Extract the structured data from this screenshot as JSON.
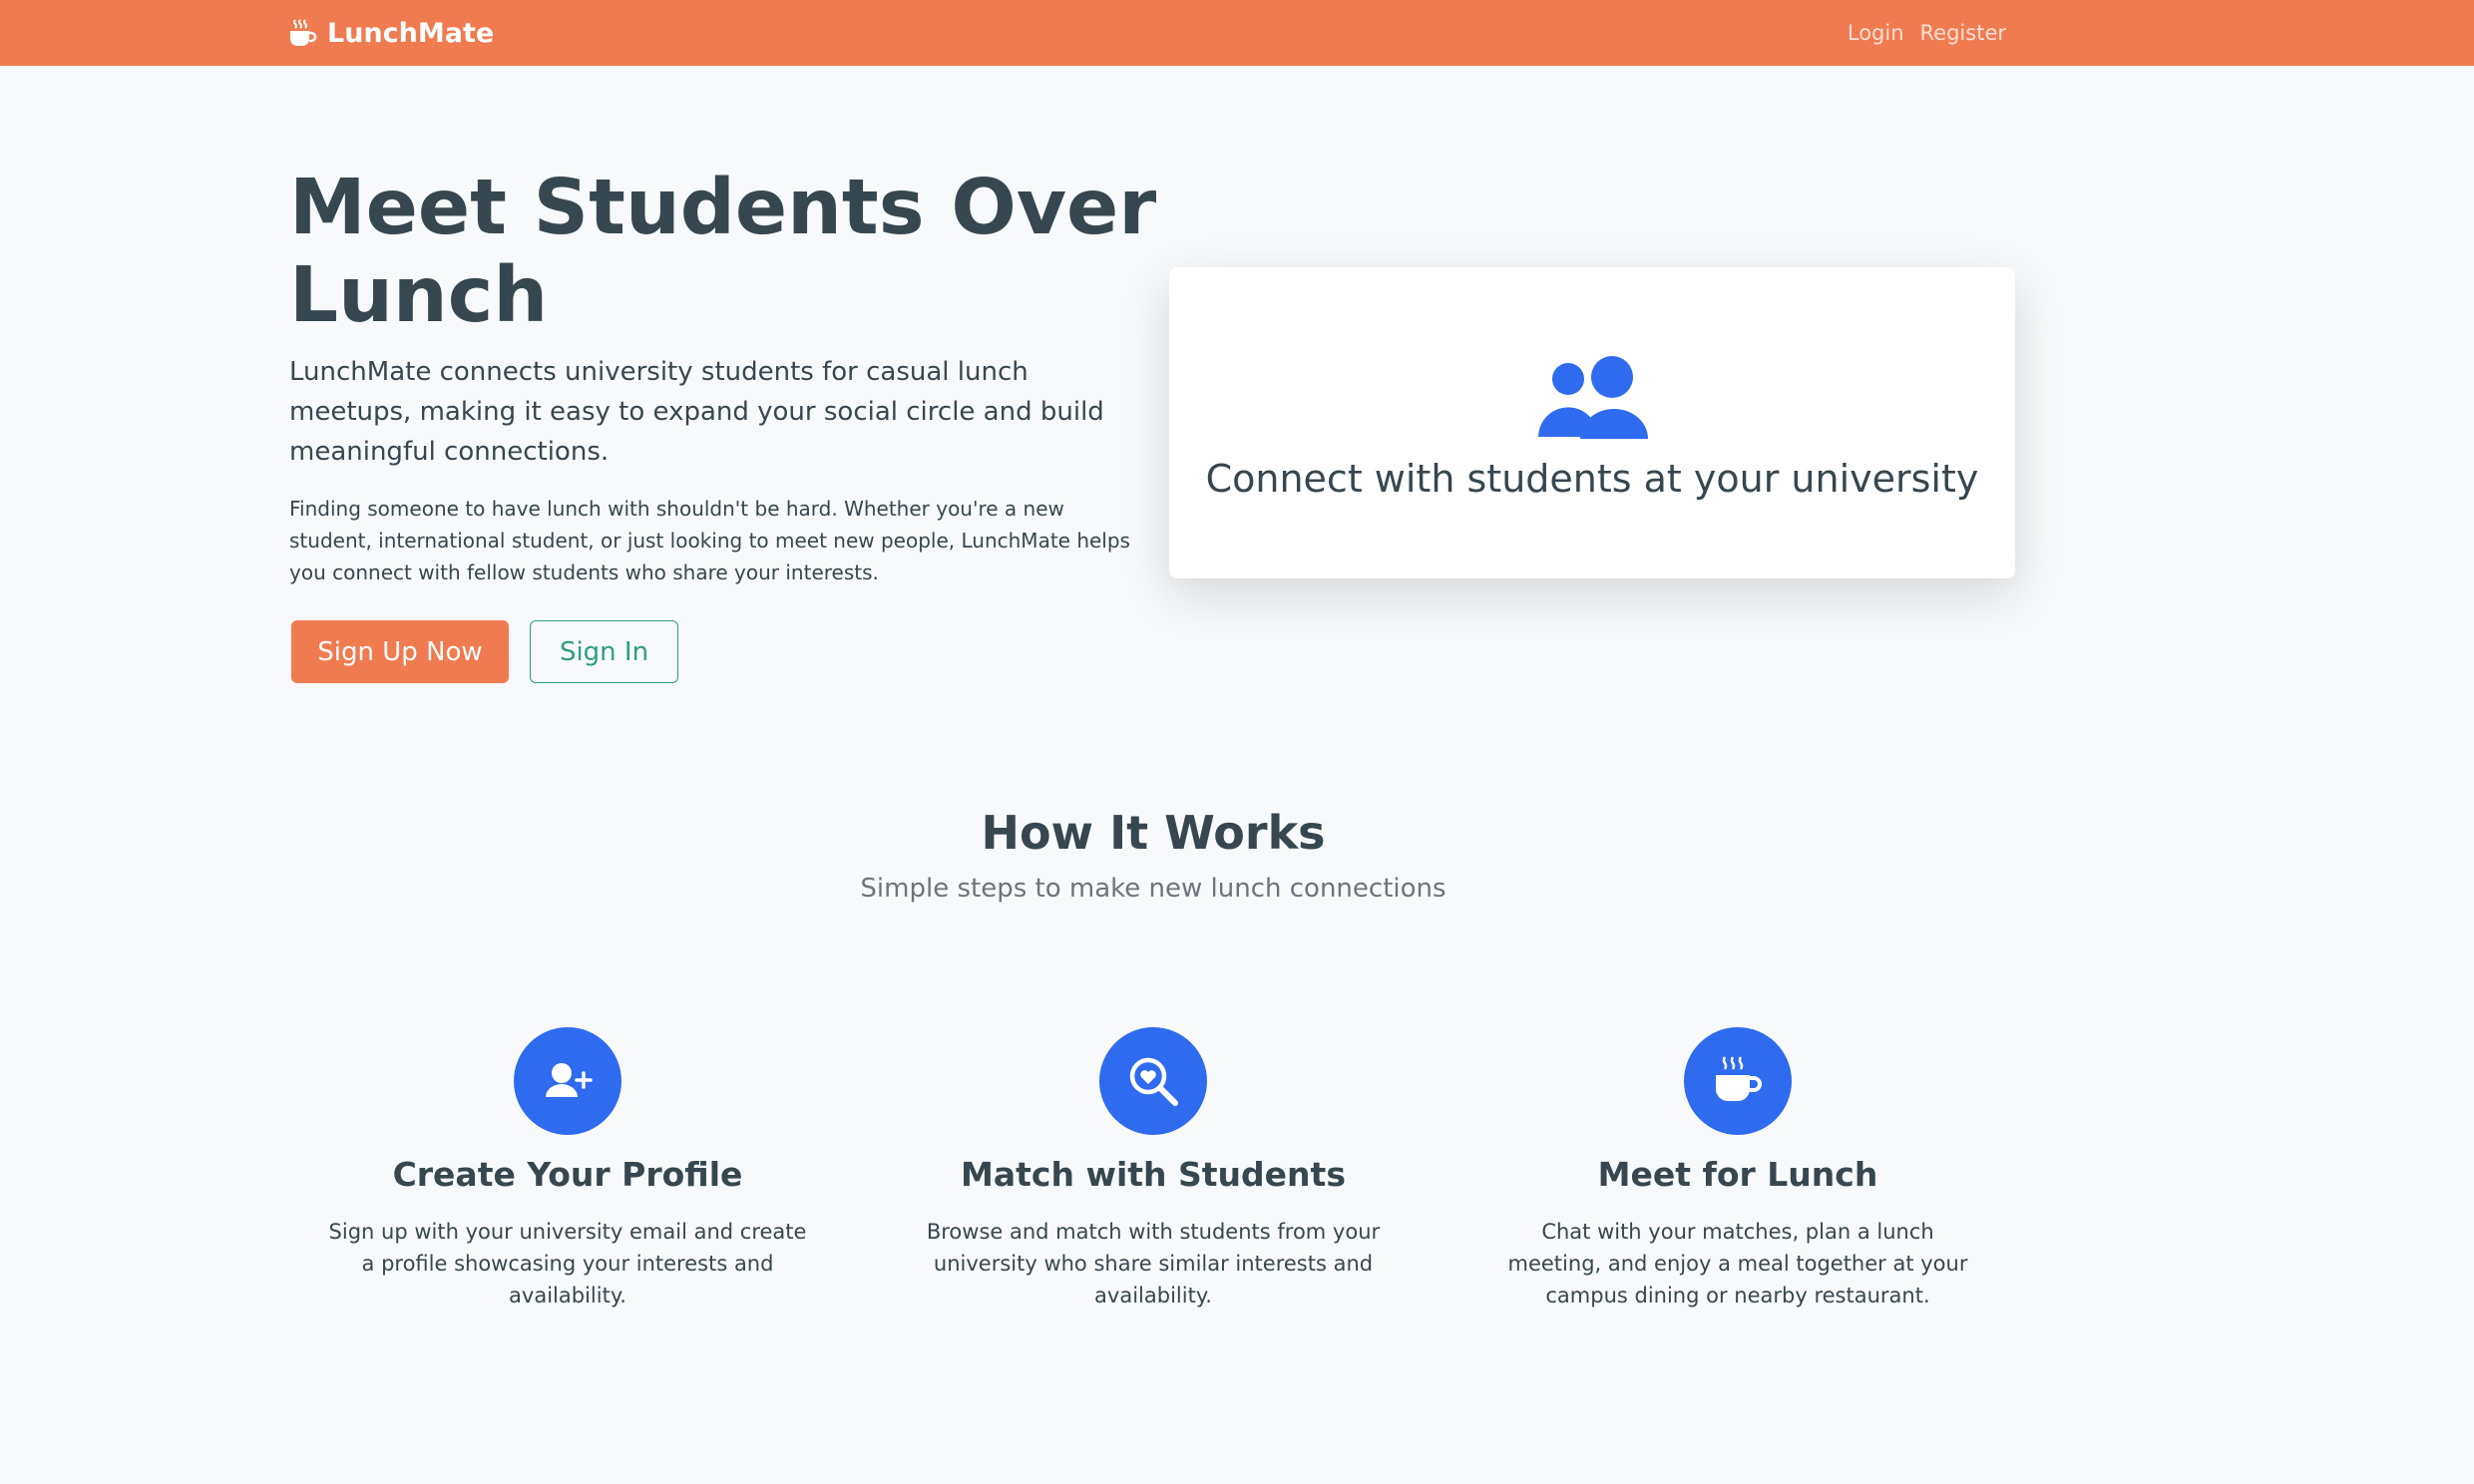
{
  "navbar": {
    "brand": "LunchMate",
    "login": "Login",
    "register": "Register"
  },
  "hero": {
    "title": "Meet Students Over Lunch",
    "lead": "LunchMate connects university students for casual lunch meetups, making it easy to expand your social circle and build meaningful connections.",
    "text": "Finding someone to have lunch with shouldn't be hard. Whether you're a new student, international student, or just looking to meet new people, LunchMate helps you connect with fellow students who share your interests.",
    "signup_label": "Sign Up Now",
    "signin_label": "Sign In",
    "card_caption": "Connect with students at your university"
  },
  "how": {
    "title": "How It Works",
    "subtitle": "Simple steps to make new lunch connections",
    "steps": [
      {
        "icon": "user-plus-icon",
        "title": "Create Your Profile",
        "desc": "Sign up with your university email and create a profile showcasing your interests and availability."
      },
      {
        "icon": "search-heart-icon",
        "title": "Match with Students",
        "desc": "Browse and match with students from your university who share similar interests and availability."
      },
      {
        "icon": "coffee-cup-icon",
        "title": "Meet for Lunch",
        "desc": "Chat with your matches, plan a lunch meeting, and enjoy a meal together at your campus dining or nearby restaurant."
      }
    ]
  },
  "colors": {
    "brand": "#f07b51",
    "accent_blue": "#2f6bef",
    "accent_teal": "#2e9e86",
    "text": "#37474f",
    "background": "#f8f9fa"
  }
}
